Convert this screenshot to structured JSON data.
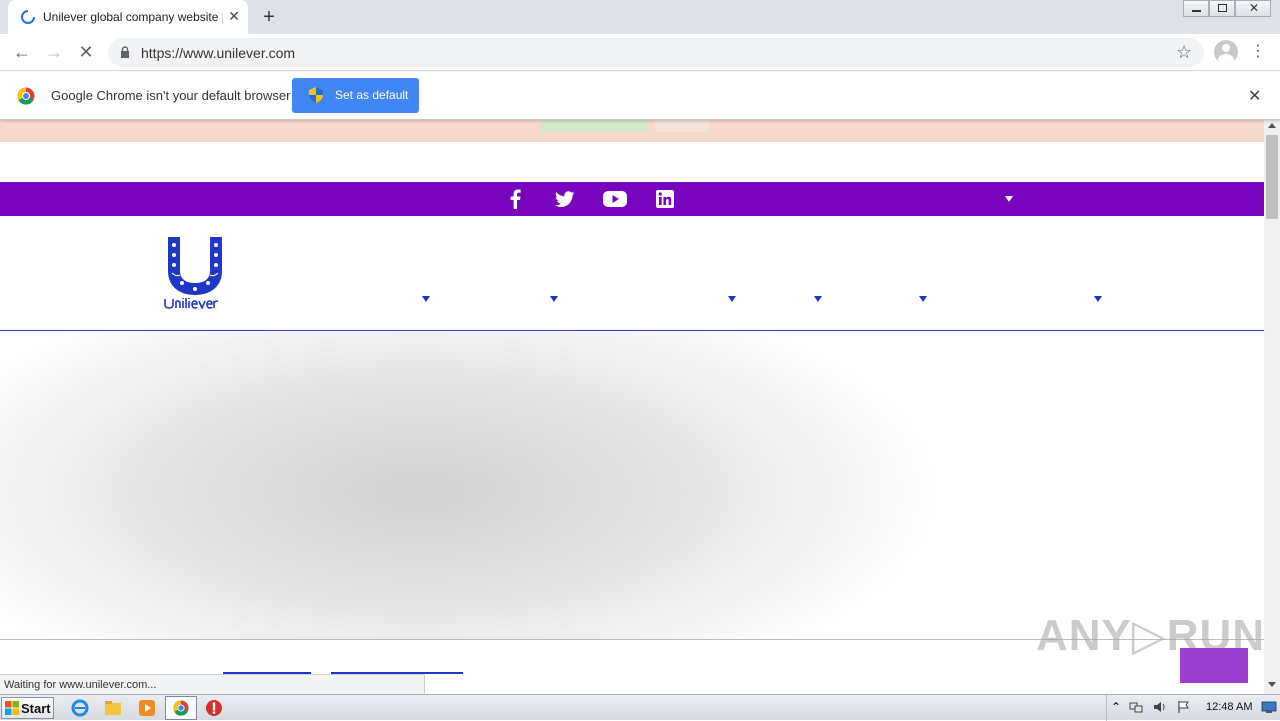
{
  "browser": {
    "tab_title": "Unilever global company website | Unilever",
    "new_tab_label": "+",
    "url": "https://www.unilever.com"
  },
  "infobar": {
    "message": "Google Chrome isn't your default browser",
    "button_label": "Set as default",
    "close_label": "✕"
  },
  "page": {
    "status_text": "Waiting for www.unilever.com...",
    "watermark": "ANY▷RUN"
  },
  "taskbar": {
    "start_label": "Start",
    "clock": "12:48 AM"
  },
  "colors": {
    "brand_purple": "#7a05bf",
    "unilever_blue": "#1f36c7",
    "chrome_blue": "#4285f4"
  }
}
